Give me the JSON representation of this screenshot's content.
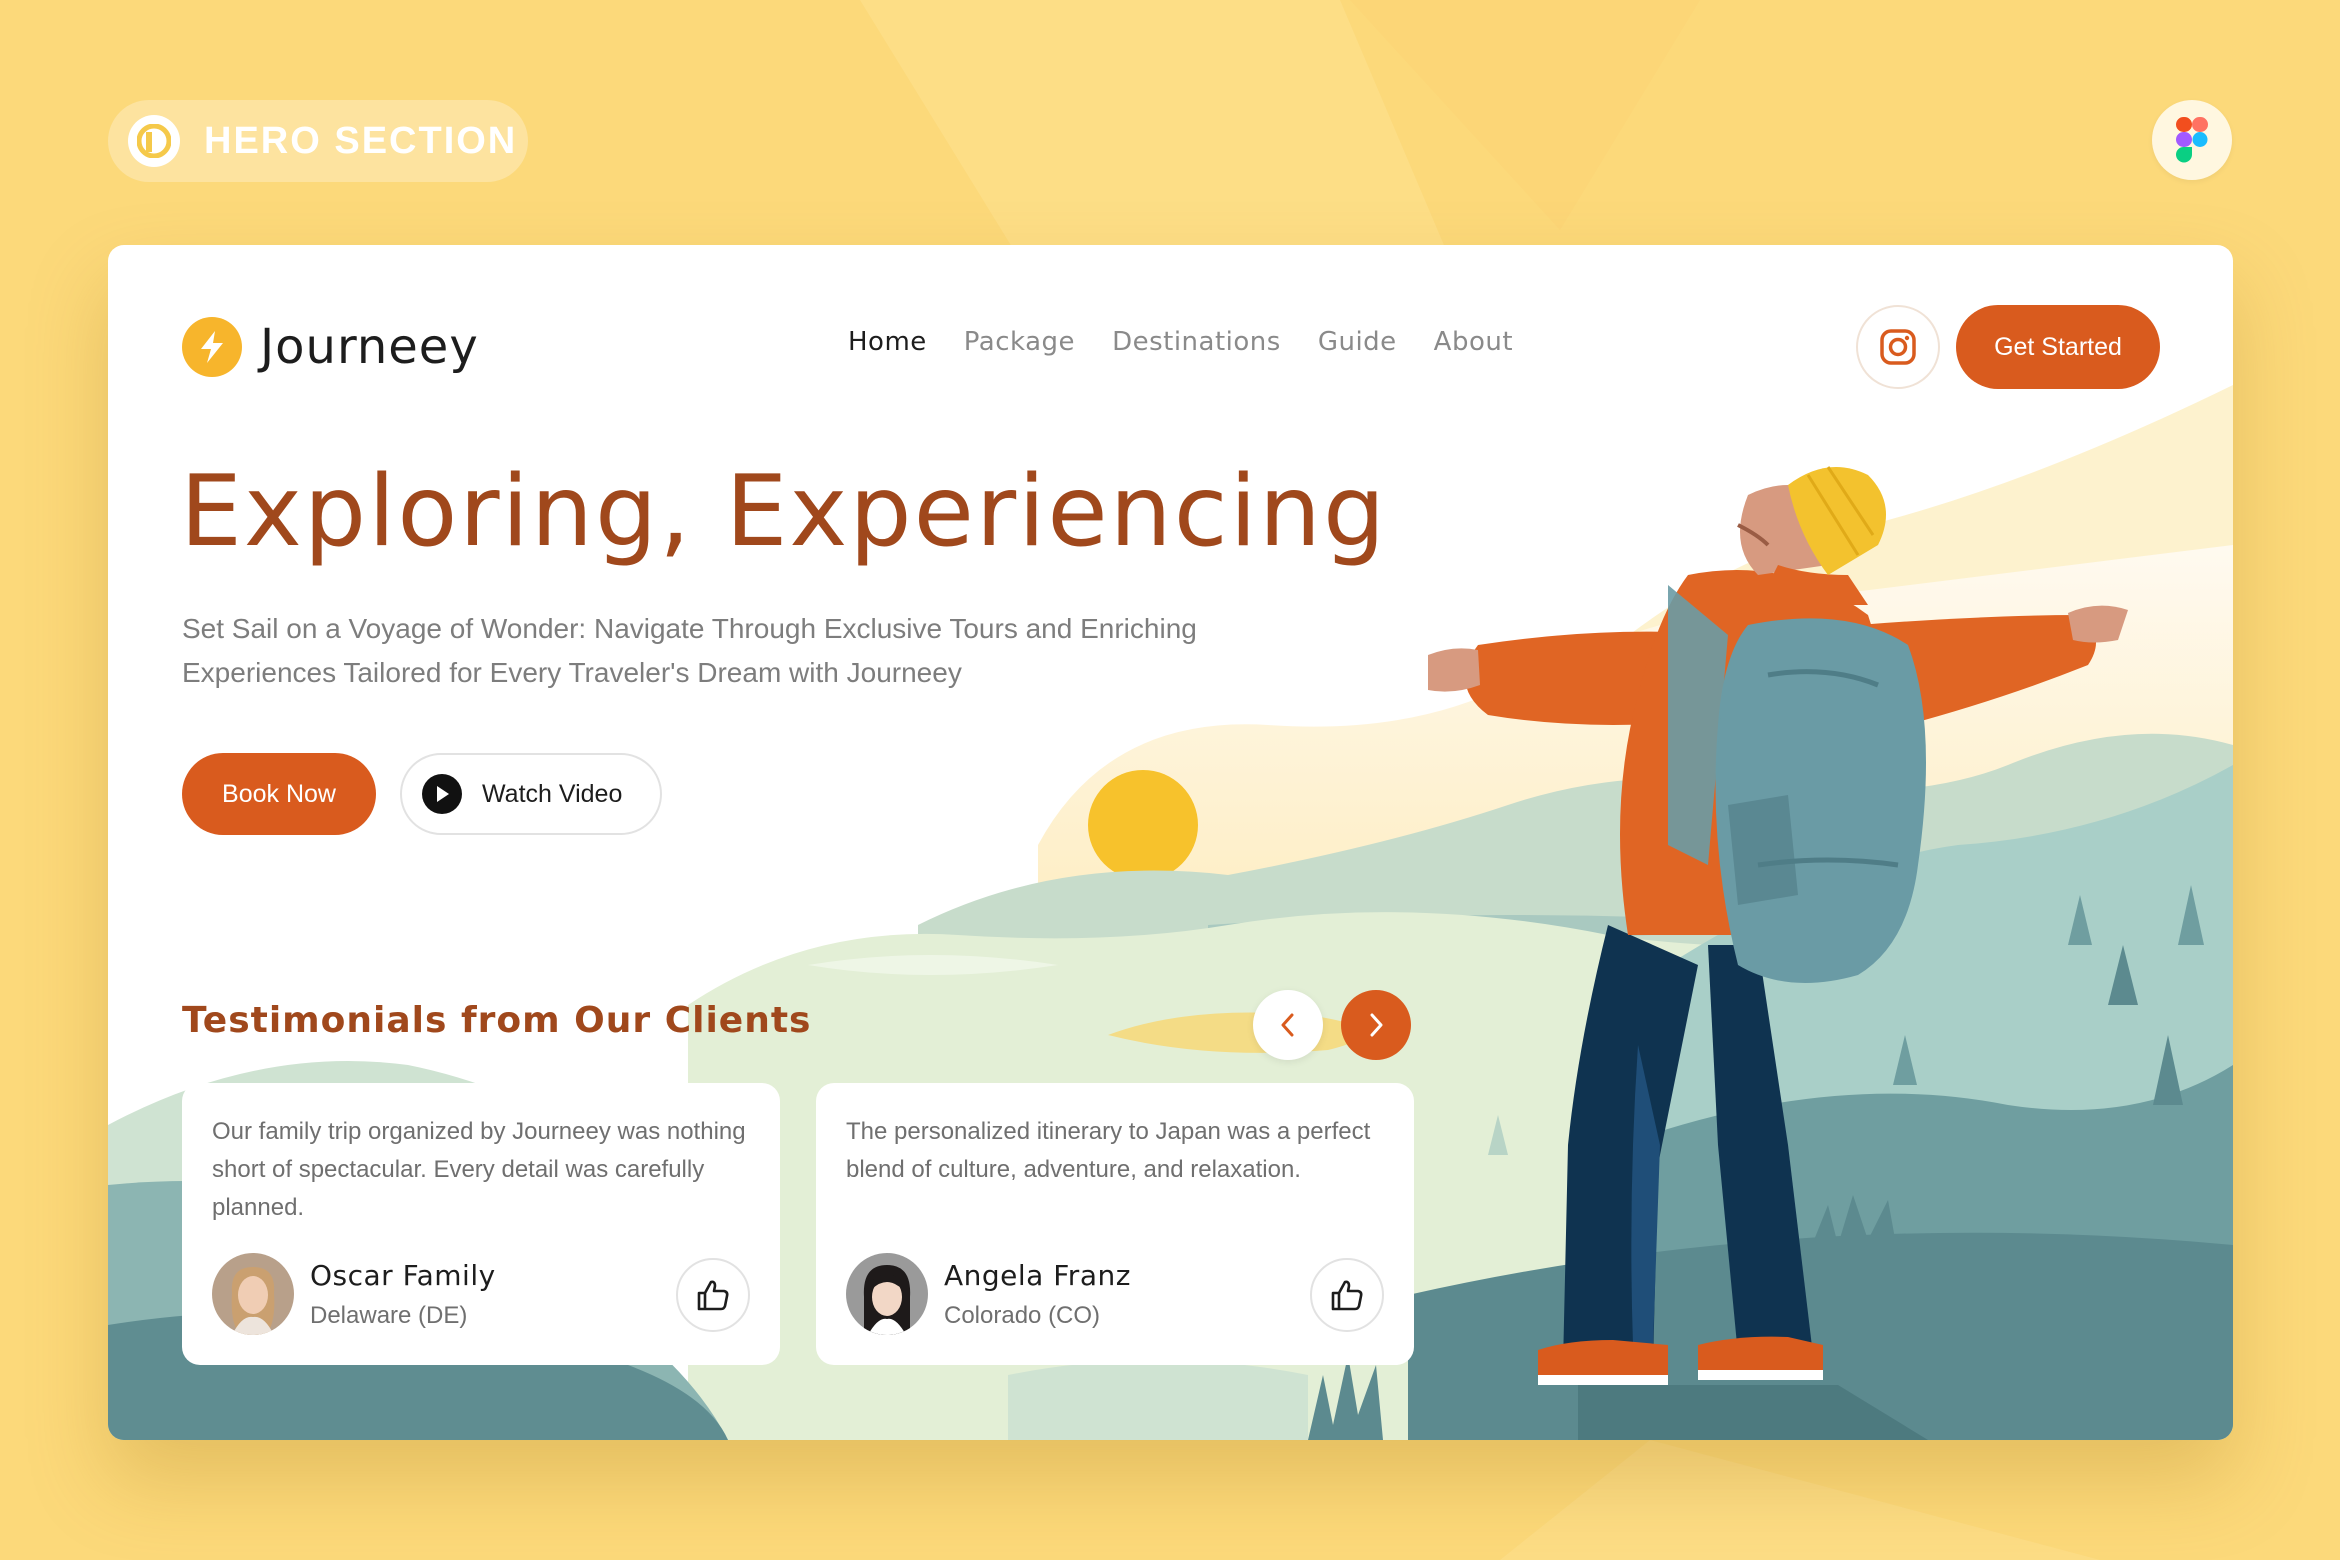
{
  "badge": {
    "label": "HERO SECTION",
    "logo_icon": "brand-p-icon"
  },
  "figma": {
    "icon": "figma-icon"
  },
  "brand": {
    "name": "Journeey",
    "icon": "lightning-bolt-icon",
    "color": "#f7b52c"
  },
  "nav": {
    "items": [
      {
        "label": "Home",
        "active": true
      },
      {
        "label": "Package",
        "active": false
      },
      {
        "label": "Destinations",
        "active": false
      },
      {
        "label": "Guide",
        "active": false
      },
      {
        "label": "About",
        "active": false
      }
    ]
  },
  "header": {
    "instagram_icon": "instagram-icon",
    "cta_label": "Get Started"
  },
  "hero": {
    "title": "Exploring, Experiencing",
    "subtitle": "Set Sail on a Voyage of Wonder: Navigate Through Exclusive Tours and Enriching Experiences Tailored for Every Traveler's Dream with Journeey",
    "primary_button": "Book Now",
    "secondary_button": "Watch Video",
    "secondary_icon": "play-icon"
  },
  "testimonials": {
    "title": "Testimonials from Our Clients",
    "prev_icon": "chevron-left-icon",
    "next_icon": "chevron-right-icon",
    "items": [
      {
        "quote": "Our family trip organized by Journeey was nothing short of spectacular. Every detail was carefully planned.",
        "name": "Oscar Family",
        "location": "Delaware (DE)",
        "like_icon": "thumbs-up-icon"
      },
      {
        "quote": "The personalized itinerary to Japan was a perfect blend of culture, adventure, and relaxation.",
        "name": "Angela Franz",
        "location": "Colorado (CO)",
        "like_icon": "thumbs-up-icon"
      }
    ]
  },
  "colors": {
    "accent": "#d95b1e",
    "title": "#a0481c",
    "background": "#fcd97a"
  }
}
